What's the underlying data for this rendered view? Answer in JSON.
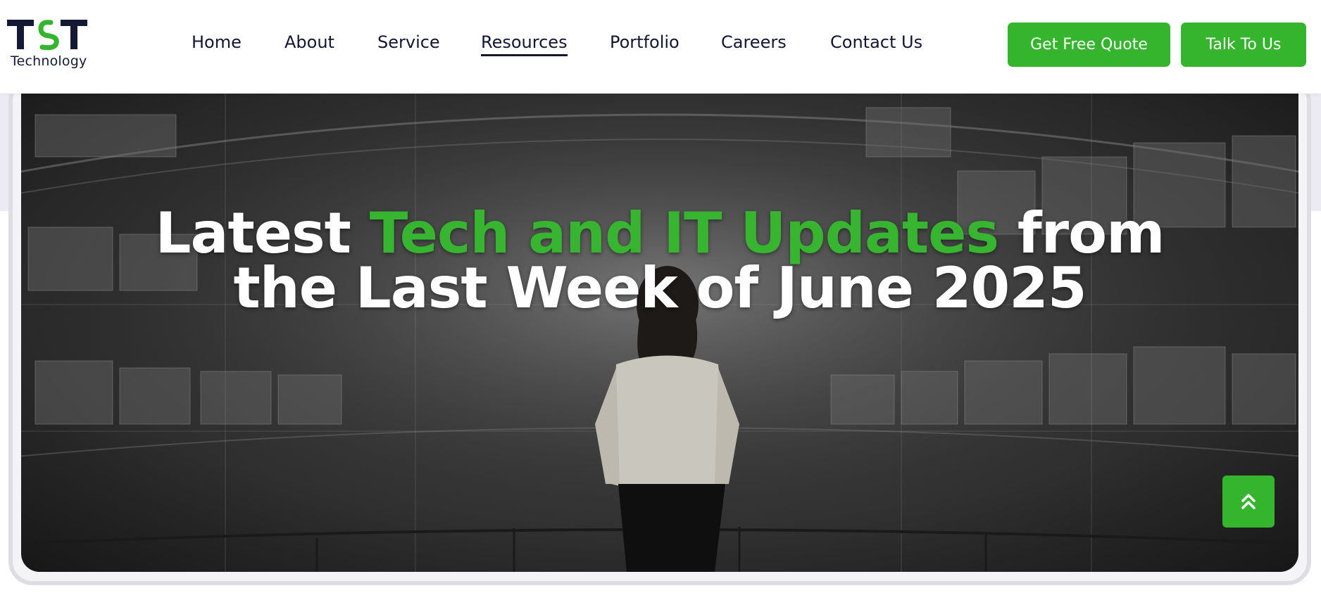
{
  "brand": {
    "logo_mark": "TST",
    "logo_text": "Technology",
    "accent_color": "#35b52e",
    "text_color": "#121633"
  },
  "nav": {
    "items": [
      {
        "label": "Home"
      },
      {
        "label": "About"
      },
      {
        "label": "Service"
      },
      {
        "label": "Resources",
        "active": true
      },
      {
        "label": "Portfolio"
      },
      {
        "label": "Careers"
      },
      {
        "label": "Contact Us"
      }
    ]
  },
  "actions": {
    "quote_label": "Get Free Quote",
    "talk_label": "Talk To Us"
  },
  "hero": {
    "headline_prefix": "Latest",
    "headline_highlight": "Tech and IT Updates",
    "headline_suffix": "from",
    "headline_line2": "the Last Week of June 2025",
    "image": "woman-facing-data-screens-grayscale"
  },
  "scroll_top": {
    "icon": "double-chevron-up-icon"
  }
}
